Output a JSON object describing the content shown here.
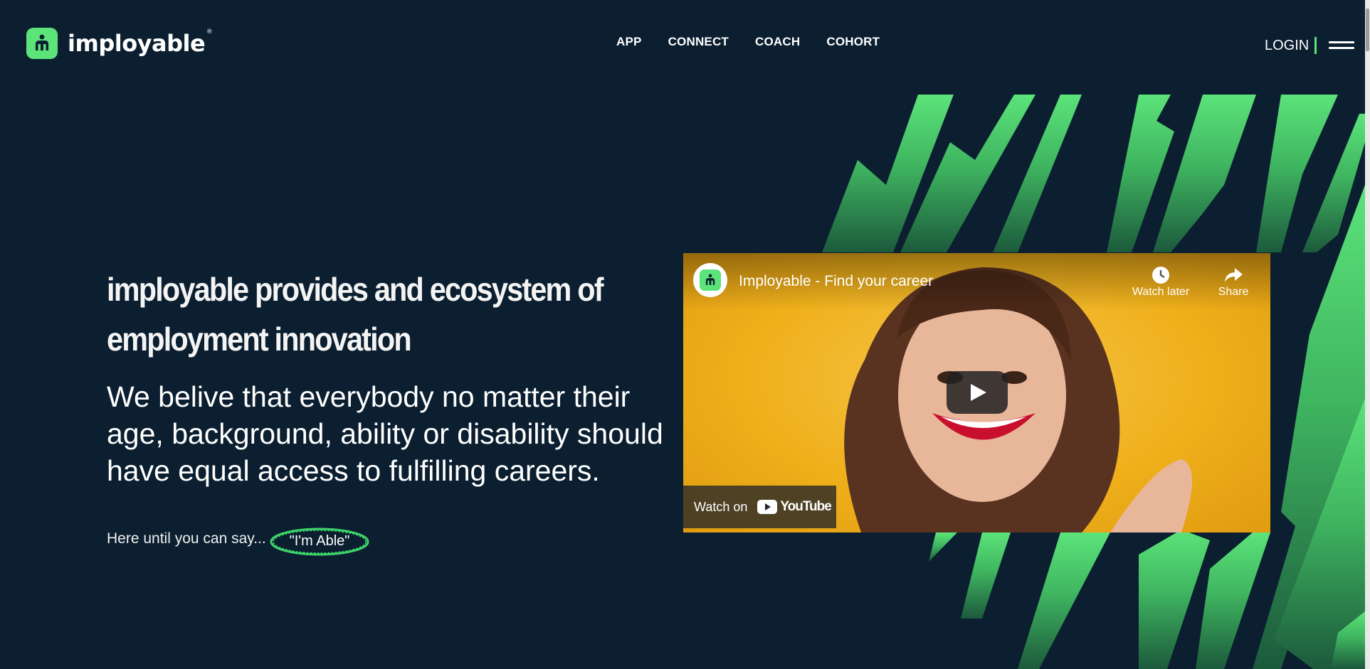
{
  "brand": {
    "name": "imployable",
    "reg_mark": "®",
    "accent": "#5ce37a",
    "background": "#0b1f30"
  },
  "nav": {
    "items": [
      "APP",
      "CONNECT",
      "COACH",
      "COHORT"
    ]
  },
  "header": {
    "login_label": "LOGIN",
    "menu_icon": "hamburger-icon"
  },
  "hero": {
    "headline": "imployable provides and ecosystem of employment innovation",
    "subtext": "We belive that everybody no matter their age, background, ability or disability should have equal access to fulfilling careers.",
    "tagline": "Here until you can say...",
    "able_quote": "\"I'm Able\""
  },
  "video": {
    "title": "Imployable - Find your career",
    "watch_later_label": "Watch later",
    "share_label": "Share",
    "watch_on_label": "Watch on",
    "youtube_label": "YouTube",
    "play_icon": "play-icon"
  }
}
